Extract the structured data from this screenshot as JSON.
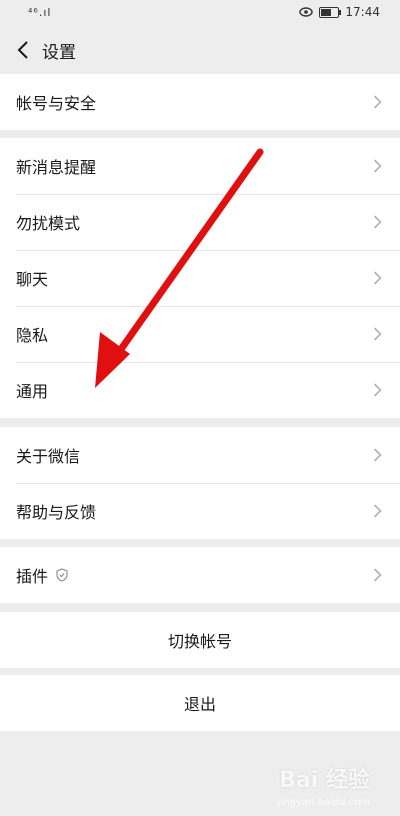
{
  "status_bar": {
    "signal": "⁴⁶.ıl",
    "time": "17:44"
  },
  "header": {
    "title": "设置"
  },
  "groups": {
    "account": {
      "label": "帐号与安全"
    },
    "notify": {
      "label": "新消息提醒"
    },
    "dnd": {
      "label": "勿扰模式"
    },
    "chat": {
      "label": "聊天"
    },
    "privacy": {
      "label": "隐私"
    },
    "general": {
      "label": "通用"
    },
    "about": {
      "label": "关于微信"
    },
    "help": {
      "label": "帮助与反馈"
    },
    "plugins": {
      "label": "插件"
    },
    "switch_account": {
      "label": "切换帐号"
    },
    "logout": {
      "label": "退出"
    }
  },
  "icons": {
    "back": "back-icon",
    "chevron": "chevron-right-icon",
    "plugin_badge": "shield-icon",
    "eye": "eye-icon",
    "battery": "battery-icon",
    "wifi": "wifi-icon"
  },
  "colors": {
    "background": "#ededed",
    "cell": "#ffffff",
    "annotation_arrow": "#e01010"
  },
  "watermark": {
    "text": "Bai 经验",
    "sub": "jingyan.baidu.com"
  }
}
